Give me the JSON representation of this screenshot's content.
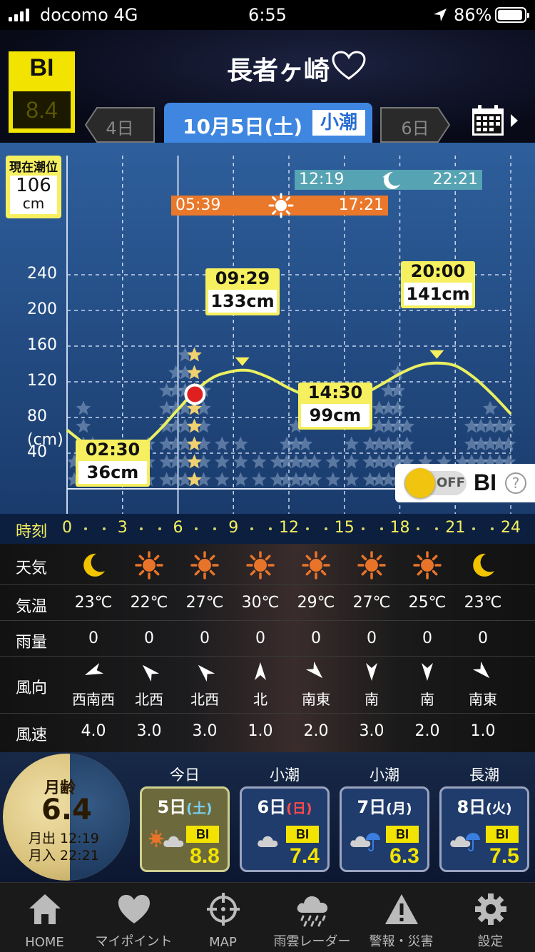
{
  "status": {
    "carrier": "docomo 4G",
    "time": "6:55",
    "battery": "86%"
  },
  "header": {
    "bi_label": "BI",
    "bi_value": "8.4",
    "title": "長者ヶ崎",
    "prev_tab": "4日",
    "current_date": "10月5日(土)",
    "current_tide": "小潮",
    "next_tab": "6日"
  },
  "chart": {
    "current_tide_label": "現在潮位",
    "current_tide_value": "106",
    "current_tide_unit": "cm",
    "moon_rise": "12:19",
    "moon_set": "22:21",
    "sun_rise": "05:39",
    "sun_set": "17:21",
    "y_unit": "(cm)",
    "tide_events": [
      {
        "time": "02:30",
        "height": "36cm"
      },
      {
        "time": "09:29",
        "height": "133cm"
      },
      {
        "time": "14:30",
        "height": "99cm"
      },
      {
        "time": "20:00",
        "height": "141cm"
      }
    ],
    "bi_toggle_state": "OFF",
    "bi_toggle_label": "BI",
    "help_symbol": "?"
  },
  "chart_data": {
    "type": "line",
    "title": "",
    "xlabel": "時刻",
    "ylabel": "(cm)",
    "xlim": [
      0,
      24
    ],
    "ylim": [
      -40,
      240
    ],
    "x_ticks": [
      0,
      3,
      6,
      9,
      12,
      15,
      18,
      21,
      24
    ],
    "y_ticks": [
      -40,
      40,
      80,
      120,
      160,
      200,
      240
    ],
    "series": [
      {
        "x": [
          0,
          1,
          2,
          2.5,
          3,
          4,
          5,
          6,
          7,
          8,
          9,
          9.48,
          10,
          11,
          12,
          13,
          14,
          14.5,
          15,
          16,
          17,
          18,
          19,
          20,
          21,
          22,
          23,
          24
        ],
        "values": [
          66,
          50,
          39,
          36,
          37,
          47,
          66,
          89,
          111,
          126,
          132,
          133,
          132,
          124,
          113,
          104,
          99,
          99,
          100,
          106,
          117,
          129,
          138,
          141,
          138,
          125,
          106,
          84
        ]
      }
    ],
    "current_point": {
      "x": 6.92,
      "y": 106
    },
    "bi_hours": [
      0,
      0.5,
      1,
      2,
      3,
      4,
      5,
      5.5,
      6,
      6.5,
      7,
      8,
      9,
      10,
      11,
      11.5,
      12,
      12.5,
      13,
      14,
      15,
      16,
      16.5,
      17,
      17.5,
      18,
      19,
      20,
      21,
      21.5,
      22,
      22.5,
      23,
      23.5
    ],
    "bi_levels": [
      40,
      100,
      60,
      40,
      40,
      60,
      120,
      140,
      150,
      150,
      120,
      60,
      60,
      40,
      40,
      60,
      70,
      60,
      40,
      40,
      60,
      60,
      100,
      120,
      140,
      80,
      40,
      40,
      40,
      80,
      80,
      100,
      80,
      80
    ],
    "annotations": [
      "02:30 36cm",
      "09:29 133cm",
      "14:30 99cm",
      "20:00 141cm"
    ]
  },
  "timeaxis": {
    "label": "時刻",
    "hours": [
      "0",
      "3",
      "6",
      "9",
      "12",
      "15",
      "18",
      "21",
      "24"
    ]
  },
  "weather": {
    "labels": {
      "weather": "天気",
      "temp": "気温",
      "rain": "雨量",
      "wind_dir": "風向",
      "wind_speed": "風速"
    },
    "icons": [
      "moon-icon",
      "sun-icon",
      "sun-icon",
      "sun-icon",
      "sun-icon",
      "sun-icon",
      "sun-icon",
      "moon-icon"
    ],
    "temps": [
      "23℃",
      "22℃",
      "27℃",
      "30℃",
      "29℃",
      "27℃",
      "25℃",
      "23℃"
    ],
    "rain": [
      "0",
      "0",
      "0",
      "0",
      "0",
      "0",
      "0",
      "0"
    ],
    "wind_dirs": [
      "西南西",
      "北西",
      "北西",
      "北",
      "南東",
      "南",
      "南",
      "南東"
    ],
    "wind_angles": [
      -112,
      -45,
      -45,
      0,
      135,
      180,
      180,
      135
    ],
    "wind_speeds": [
      "4.0",
      "3.0",
      "3.0",
      "1.0",
      "2.0",
      "3.0",
      "2.0",
      "1.0"
    ]
  },
  "forecast": {
    "moon_age_label": "月齢",
    "moon_age": "6.4",
    "moon_rise": "月出 12:19",
    "moon_set": "月入 22:21",
    "days": [
      {
        "head": "今日",
        "date": "5日",
        "weekday": "(土)",
        "weekday_color": "#7ad0f0",
        "bi": "BI",
        "value": "8.8",
        "icon": "sun-cloud-icon"
      },
      {
        "head": "小潮",
        "date": "6日",
        "weekday": "(日)",
        "weekday_color": "#ff4a4a",
        "bi": "BI",
        "value": "7.4",
        "icon": "cloud-icon"
      },
      {
        "head": "小潮",
        "date": "7日",
        "weekday": "(月)",
        "weekday_color": "#ffffff",
        "bi": "BI",
        "value": "6.3",
        "icon": "cloud-umbrella-icon"
      },
      {
        "head": "長潮",
        "date": "8日",
        "weekday": "(火)",
        "weekday_color": "#ffffff",
        "bi": "BI",
        "value": "7.5",
        "icon": "cloud-umbrella-icon"
      }
    ]
  },
  "tabbar": {
    "items": [
      {
        "label": "HOME",
        "icon": "home-icon"
      },
      {
        "label": "マイポイント",
        "icon": "heart-icon"
      },
      {
        "label": "MAP",
        "icon": "crosshair-icon"
      },
      {
        "label": "雨雲レーダー",
        "icon": "rain-cloud-icon"
      },
      {
        "label": "警報・災害",
        "icon": "warning-icon"
      },
      {
        "label": "設定",
        "icon": "gear-icon"
      }
    ]
  }
}
